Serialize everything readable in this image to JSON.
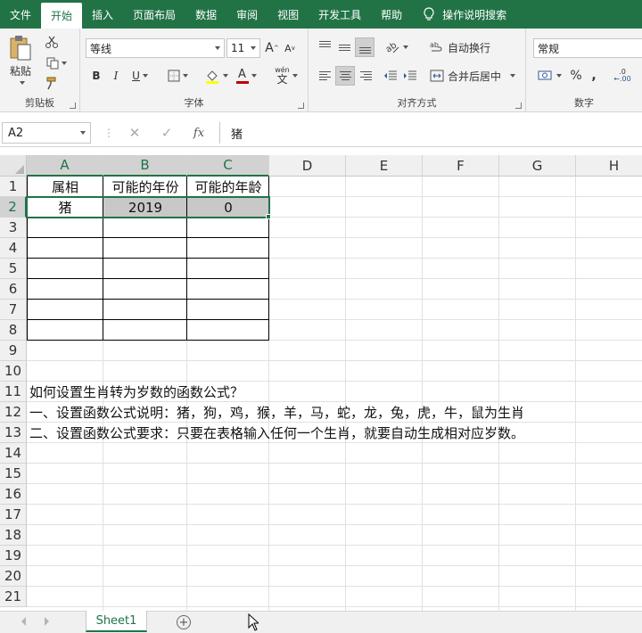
{
  "menu": {
    "tabs": [
      "文件",
      "开始",
      "插入",
      "页面布局",
      "数据",
      "审阅",
      "视图",
      "开发工具",
      "帮助"
    ],
    "active": 1,
    "tell_me": "操作说明搜索"
  },
  "ribbon": {
    "clipboard": {
      "label": "剪贴板",
      "paste": "粘贴"
    },
    "font": {
      "label": "字体",
      "name": "等线",
      "size": "11",
      "bold": "B",
      "italic": "I",
      "underline": "U",
      "grow": "A",
      "shrink": "A",
      "phonetic_top": "wén",
      "phonetic_bottom": "文",
      "font_color_letter": "A"
    },
    "alignment": {
      "label": "对齐方式",
      "wrap_text": "自动换行",
      "merge_center": "合并后居中"
    },
    "number": {
      "label": "数字",
      "format": "常规",
      "percent": "%",
      "comma": ",",
      "inc_decimal": ".0",
      "dec_decimal": ".00"
    }
  },
  "formula_bar": {
    "name_box": "A2",
    "cancel": "✕",
    "enter": "✓",
    "fx": "fx",
    "content": "猪"
  },
  "grid": {
    "columns": [
      "A",
      "B",
      "C",
      "D",
      "E",
      "F",
      "G",
      "H"
    ],
    "rows": [
      "1",
      "2",
      "3",
      "4",
      "5",
      "6",
      "7",
      "8",
      "9",
      "10",
      "11",
      "12",
      "13",
      "14",
      "15",
      "16",
      "17",
      "18",
      "19",
      "20",
      "21"
    ],
    "cells": {
      "A1": "属相",
      "B1": "可能的年份",
      "C1": "可能的年龄",
      "A2": "猪",
      "B2": "2019",
      "C2": "0",
      "A11": "如何设置生肖转为岁数的函数公式？",
      "A12": "一、设置函数公式说明：猪，狗，鸡，猴，羊，马，蛇，龙，兔，虎，牛，鼠为生肖",
      "A13": "二、设置函数公式要求：只要在表格输入任何一个生肖，就要自动生成相对应岁数。"
    }
  },
  "sheets": {
    "tabs": [
      "Sheet1"
    ],
    "add": "+"
  },
  "colors": {
    "accent": "#217346"
  }
}
